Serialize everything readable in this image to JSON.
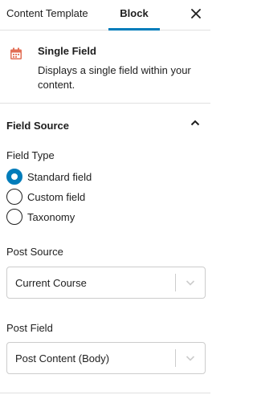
{
  "tabs": {
    "content_template": "Content Template",
    "block": "Block",
    "active": "Block"
  },
  "close_icon": "close-icon",
  "block": {
    "icon": "calendar-icon",
    "icon_color": "#e26f56",
    "title": "Single Field",
    "description": "Displays a single field within your content."
  },
  "panel": {
    "title": "Field Source",
    "expanded": true,
    "field_type": {
      "label": "Field Type",
      "options": [
        "Standard field",
        "Custom field",
        "Taxonomy"
      ],
      "selected": "Standard field"
    },
    "post_source": {
      "label": "Post Source",
      "value": "Current Course"
    },
    "post_field": {
      "label": "Post Field",
      "value": "Post Content (Body)"
    }
  },
  "colors": {
    "accent": "#007cba",
    "border": "#e0e0e0",
    "text": "#1e1e1e"
  }
}
